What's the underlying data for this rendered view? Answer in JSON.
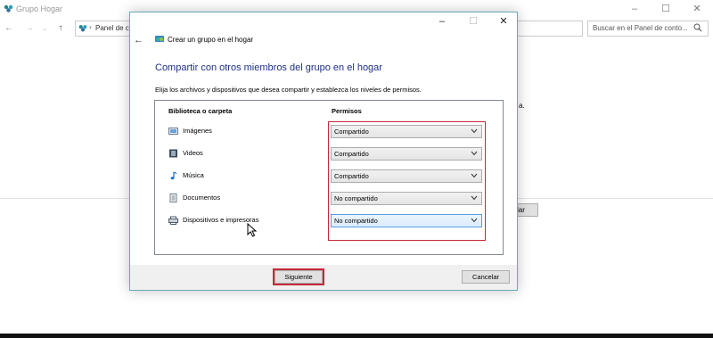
{
  "background_window": {
    "title": "Grupo Hogar",
    "address": "Panel de co",
    "search_placeholder": "Buscar en el Panel de conto...",
    "button_fragment": "lar",
    "dot_text": "a."
  },
  "dialog": {
    "title": "Crear un grupo en el hogar",
    "heading": "Compartir con otros miembros del grupo en el hogar",
    "instructions": "Elija los archivos y dispositivos que desea compartir y establezca los niveles de permisos.",
    "columns": {
      "library": "Biblioteca o carpeta",
      "permissions": "Permisos"
    },
    "rows": [
      {
        "label": "Imágenes",
        "permission": "Compartido",
        "icon": "pictures-icon"
      },
      {
        "label": "Videos",
        "permission": "Compartido",
        "icon": "videos-icon"
      },
      {
        "label": "Música",
        "permission": "Compartido",
        "icon": "music-icon"
      },
      {
        "label": "Documentos",
        "permission": "No compartido",
        "icon": "documents-icon"
      },
      {
        "label": "Dispositivos e impresoras",
        "permission": "No compartido",
        "icon": "printer-icon"
      }
    ],
    "buttons": {
      "next": "Siguiente",
      "cancel": "Cancelar"
    }
  },
  "colors": {
    "accent_heading": "#1e3287",
    "highlight_red": "#c42b3a",
    "dialog_border": "#69aab7"
  }
}
